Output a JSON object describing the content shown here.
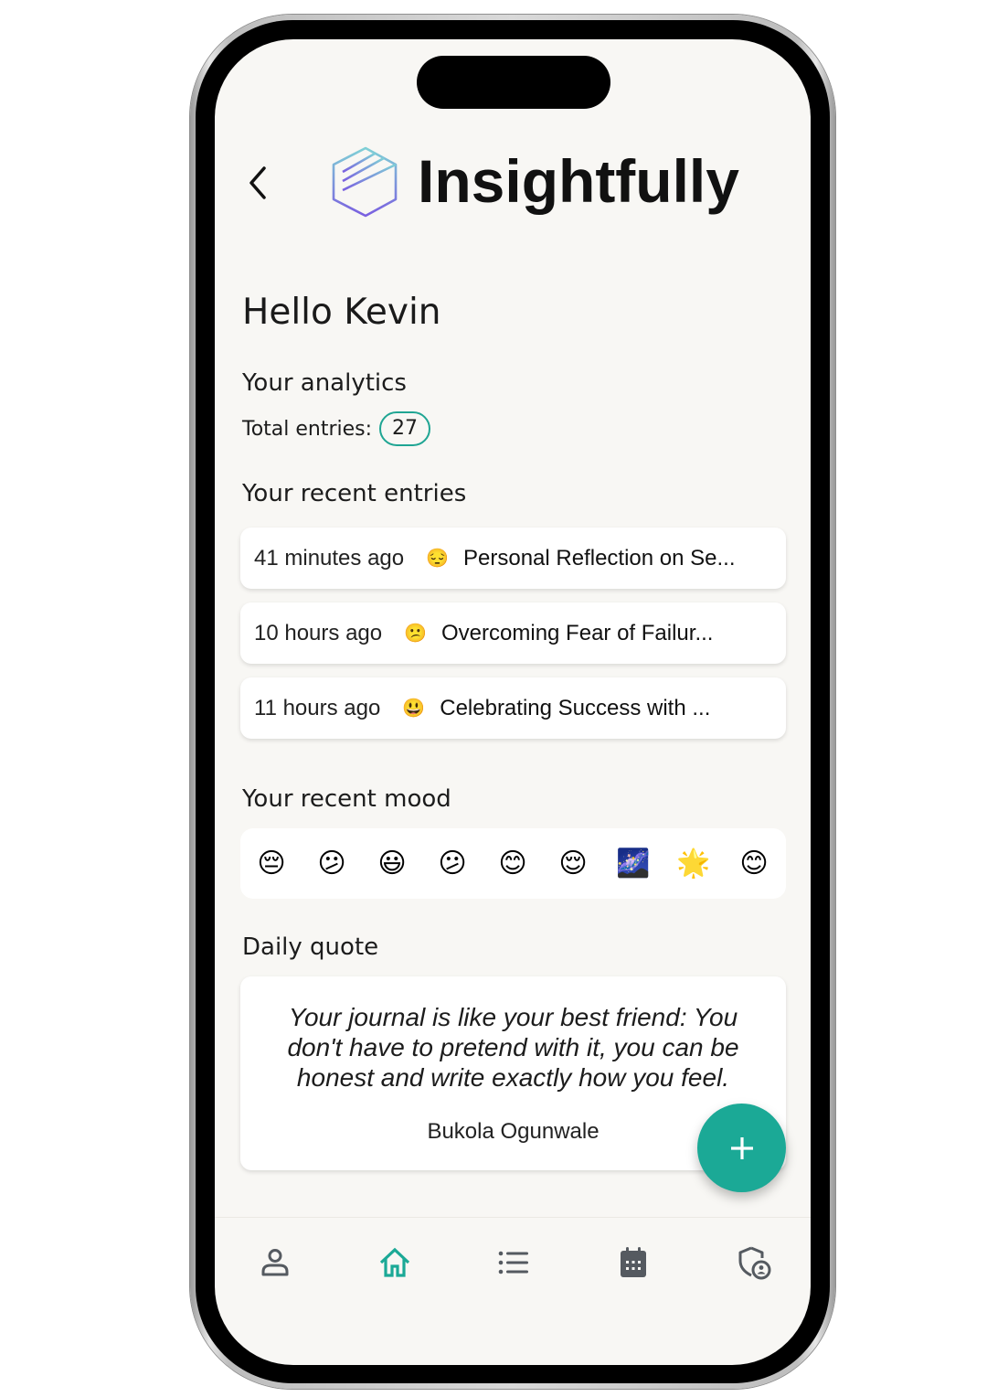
{
  "app": {
    "title": "Insightfully",
    "brand_color": "#1ba996",
    "logo_icon": "hexagon-stripes-logo"
  },
  "header": {
    "back_icon": "chevron-left-icon"
  },
  "greeting": "Hello Kevin",
  "analytics": {
    "heading": "Your analytics",
    "total_label": "Total entries:",
    "total_count": "27"
  },
  "recent_entries": {
    "heading": "Your recent entries",
    "items": [
      {
        "time": "41 minutes ago",
        "emoji": "😔",
        "title": "Personal Reflection on Se..."
      },
      {
        "time": "10 hours ago",
        "emoji": "😕",
        "title": "Overcoming Fear of Failur..."
      },
      {
        "time": "11 hours ago",
        "emoji": "😃",
        "title": "Celebrating Success with ..."
      }
    ]
  },
  "recent_mood": {
    "heading": "Your recent mood",
    "emojis": [
      "😔",
      "😕",
      "😃",
      "😕",
      "😊",
      "😌",
      "🌌",
      "🌟",
      "😊"
    ]
  },
  "daily_quote": {
    "heading": "Daily quote",
    "text": "Your journal is like your best friend: You don't have to pretend with it, you can be honest and write exactly how you feel.",
    "author": "Bukola Ogunwale"
  },
  "fab": {
    "icon": "plus-icon"
  },
  "bottom_nav": {
    "active_color": "#1ba996",
    "inactive_color": "#555a60",
    "items": [
      {
        "name": "profile",
        "icon": "person-icon",
        "active": false
      },
      {
        "name": "home",
        "icon": "home-icon",
        "active": true
      },
      {
        "name": "entries",
        "icon": "list-icon",
        "active": false
      },
      {
        "name": "calendar",
        "icon": "calendar-icon",
        "active": false
      },
      {
        "name": "privacy",
        "icon": "shield-user-icon",
        "active": false
      }
    ]
  }
}
